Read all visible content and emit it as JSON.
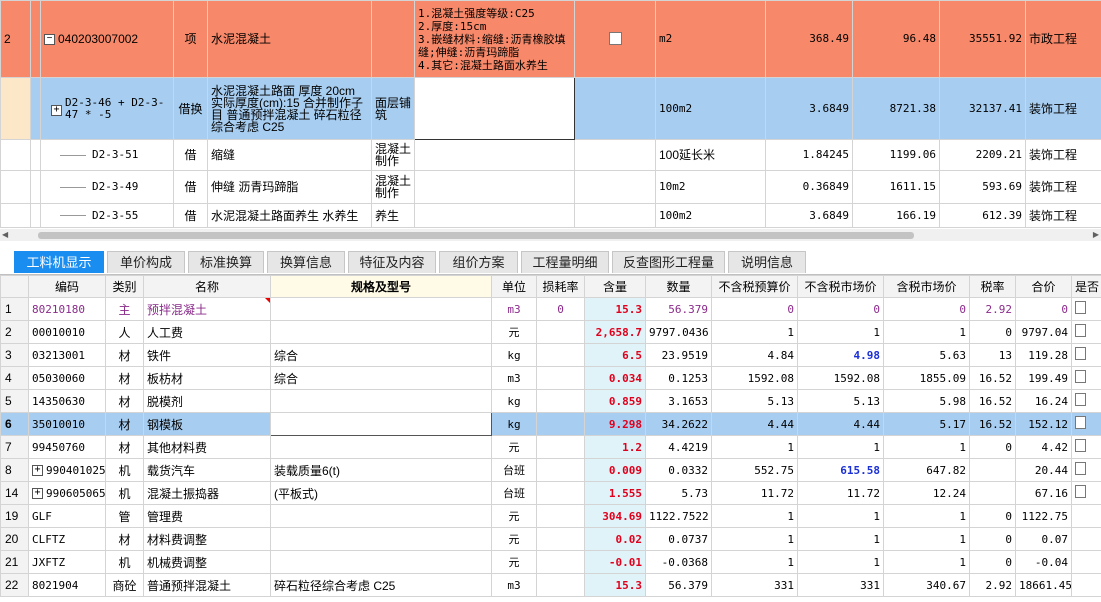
{
  "top_rows": [
    {
      "row": "2",
      "code": "040203007002",
      "type": "项",
      "name": "水泥混凝土",
      "feature": "1.混凝土强度等级:C25\n2.厚度:15cm\n3.嵌缝材料:缩缝:沥青橡胶填缝;伸缝:沥青玛蹄脂\n4.其它:混凝土路面水养生",
      "unit": "m2",
      "qty": "368.49",
      "price": "96.48",
      "total": "35551.92",
      "major": "市政工程"
    },
    {
      "row": "",
      "code": "D2-3-46 + D2-3-47 * -5",
      "type": "借换",
      "name": "水泥混凝土路面 厚度 20cm 实际厚度(cm):15 合并制作子目 普通预拌混凝土 碎石粒径综合考虑 C25",
      "item": "面层铺筑",
      "unit": "100m2",
      "qty": "3.6849",
      "price": "8721.38",
      "total": "32137.41",
      "major": "装饰工程"
    },
    {
      "code": "D2-3-51",
      "type": "借",
      "name": "缩缝",
      "item": "混凝土制作",
      "unit": "100延长米",
      "qty": "1.84245",
      "price": "1199.06",
      "total": "2209.21",
      "major": "装饰工程"
    },
    {
      "code": "D2-3-49",
      "type": "借",
      "name": "伸缝 沥青玛蹄脂",
      "item": "混凝土制作",
      "unit": "10m2",
      "qty": "0.36849",
      "price": "1611.15",
      "total": "593.69",
      "major": "装饰工程"
    },
    {
      "code": "D2-3-55",
      "type": "借",
      "name": "水泥混凝土路面养生 水养生",
      "item": "养生",
      "unit": "100m2",
      "qty": "3.6849",
      "price": "166.19",
      "total": "612.39",
      "major": "装饰工程"
    }
  ],
  "tabs": [
    "工料机显示",
    "单价构成",
    "标准换算",
    "换算信息",
    "特征及内容",
    "组价方案",
    "工程量明细",
    "反查图形工程量",
    "说明信息"
  ],
  "headers": [
    "编码",
    "类别",
    "名称",
    "规格及型号",
    "单位",
    "损耗率",
    "含量",
    "数量",
    "不含税预算价",
    "不含税市场价",
    "含税市场价",
    "税率",
    "合价",
    "是否"
  ],
  "rows": [
    {
      "no": "1",
      "code": "80210180",
      "cat": "主",
      "name": "预拌混凝土",
      "spec": "",
      "unit": "m3",
      "loss": "0",
      "content": "15.3",
      "amount": "56.379",
      "budget": "0",
      "market": "0",
      "tax_market": "0",
      "rate": "2.92",
      "total": "0"
    },
    {
      "no": "2",
      "code": "00010010",
      "cat": "人",
      "name": "人工费",
      "spec": "",
      "unit": "元",
      "loss": "",
      "content": "2,658.7",
      "amount": "9797.0436",
      "budget": "1",
      "market": "1",
      "tax_market": "1",
      "rate": "0",
      "total": "9797.04"
    },
    {
      "no": "3",
      "code": "03213001",
      "cat": "材",
      "name": "铁件",
      "spec": "综合",
      "unit": "kg",
      "loss": "",
      "content": "6.5",
      "amount": "23.9519",
      "budget": "4.84",
      "market": "4.98",
      "tax_market": "5.63",
      "rate": "13",
      "total": "119.28"
    },
    {
      "no": "4",
      "code": "05030060",
      "cat": "材",
      "name": "板枋材",
      "spec": "综合",
      "unit": "m3",
      "loss": "",
      "content": "0.034",
      "amount": "0.1253",
      "budget": "1592.08",
      "market": "1592.08",
      "tax_market": "1855.09",
      "rate": "16.52",
      "total": "199.49"
    },
    {
      "no": "5",
      "code": "14350630",
      "cat": "材",
      "name": "脱模剂",
      "spec": "",
      "unit": "kg",
      "loss": "",
      "content": "0.859",
      "amount": "3.1653",
      "budget": "5.13",
      "market": "5.13",
      "tax_market": "5.98",
      "rate": "16.52",
      "total": "16.24"
    },
    {
      "no": "6",
      "code": "35010010",
      "cat": "材",
      "name": "钢模板",
      "spec": "",
      "unit": "kg",
      "loss": "",
      "content": "9.298",
      "amount": "34.2622",
      "budget": "4.44",
      "market": "4.44",
      "tax_market": "5.17",
      "rate": "16.52",
      "total": "152.12"
    },
    {
      "no": "7",
      "code": "99450760",
      "cat": "材",
      "name": "其他材料费",
      "spec": "",
      "unit": "元",
      "loss": "",
      "content": "1.2",
      "amount": "4.4219",
      "budget": "1",
      "market": "1",
      "tax_market": "1",
      "rate": "0",
      "total": "4.42"
    },
    {
      "no": "8",
      "code": "990401025",
      "cat": "机",
      "name": "载货汽车",
      "spec": "装载质量6(t)",
      "unit": "台班",
      "loss": "",
      "content": "0.009",
      "amount": "0.0332",
      "budget": "552.75",
      "market": "615.58",
      "tax_market": "647.82",
      "rate": "",
      "total": "20.44"
    },
    {
      "no": "14",
      "code": "990605065",
      "cat": "机",
      "name": "混凝土振捣器",
      "spec": "(平板式)",
      "unit": "台班",
      "loss": "",
      "content": "1.555",
      "amount": "5.73",
      "budget": "11.72",
      "market": "11.72",
      "tax_market": "12.24",
      "rate": "",
      "total": "67.16"
    },
    {
      "no": "19",
      "code": "GLF",
      "cat": "管",
      "name": "管理费",
      "spec": "",
      "unit": "元",
      "loss": "",
      "content": "304.69",
      "amount": "1122.7522",
      "budget": "1",
      "market": "1",
      "tax_market": "1",
      "rate": "0",
      "total": "1122.75"
    },
    {
      "no": "20",
      "code": "CLFTZ",
      "cat": "材",
      "name": "材料费调整",
      "spec": "",
      "unit": "元",
      "loss": "",
      "content": "0.02",
      "amount": "0.0737",
      "budget": "1",
      "market": "1",
      "tax_market": "1",
      "rate": "0",
      "total": "0.07"
    },
    {
      "no": "21",
      "code": "JXFTZ",
      "cat": "机",
      "name": "机械费调整",
      "spec": "",
      "unit": "元",
      "loss": "",
      "content": "-0.01",
      "amount": "-0.0368",
      "budget": "1",
      "market": "1",
      "tax_market": "1",
      "rate": "0",
      "total": "-0.04"
    },
    {
      "no": "22",
      "code": "8021904",
      "cat": "商砼",
      "name": "普通预拌混凝土",
      "spec": "碎石粒径综合考虑 C25",
      "unit": "m3",
      "loss": "",
      "content": "15.3",
      "amount": "56.379",
      "budget": "331",
      "market": "331",
      "tax_market": "340.67",
      "rate": "2.92",
      "total": "18661.45"
    }
  ],
  "colors": {
    "orange": "#f7896a",
    "blue": "#a7cdf0",
    "tab_active": "#1a8ef0",
    "red": "#e1001c"
  }
}
